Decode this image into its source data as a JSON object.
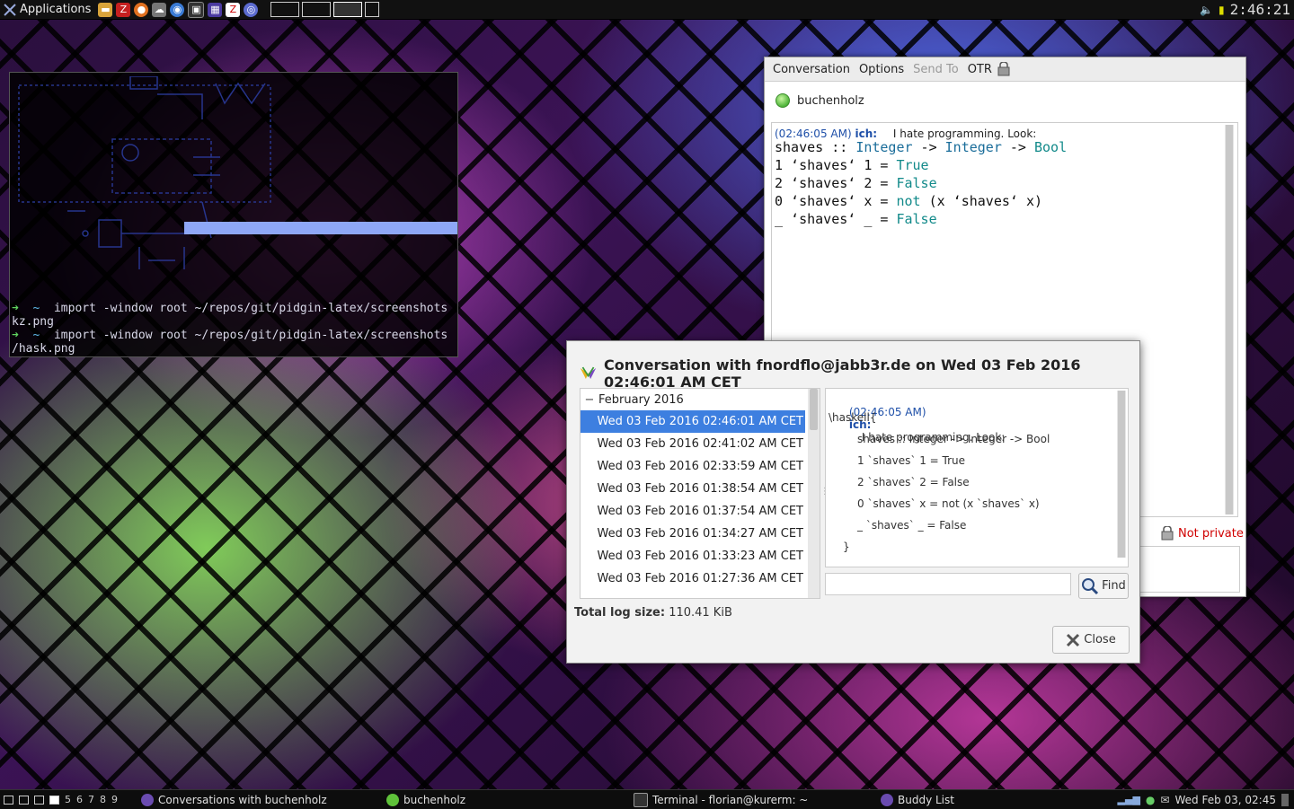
{
  "top_panel": {
    "applications_label": "Applications",
    "clock": "2:46:21"
  },
  "terminal": {
    "lines": [
      {
        "arrow": "➜",
        "tilde": "~",
        "cmd": "import -window root ~/repos/git/pidgin-latex/screenshots"
      },
      {
        "cont": "kz.png"
      },
      {
        "arrow": "➜",
        "tilde": "~",
        "cmd": "import -window root ~/repos/git/pidgin-latex/screenshots"
      },
      {
        "cont": "/hask.png"
      }
    ]
  },
  "conversation": {
    "menu": {
      "conversation": "Conversation",
      "options": "Options",
      "send_to": "Send To",
      "otr": "OTR"
    },
    "buddy": "buchenholz",
    "message": {
      "timestamp": "(02:46:05 AM)",
      "nick": "ich:",
      "text": "I hate programming. Look:"
    },
    "code": {
      "l1_a": "shaves :: ",
      "l1_t1": "Integer",
      "l1_b": " -> ",
      "l1_t2": "Integer",
      "l1_c": " -> ",
      "l1_t3": "Bool",
      "l2_a": "1 ‘shaves‘ 1 = ",
      "l2_v": "True",
      "l3_a": "2 ‘shaves‘ 2 = ",
      "l3_v": "False",
      "l4_a": "0 ‘shaves‘ x = ",
      "l4_v": "not",
      "l4_b": " (x ‘shaves‘ x)",
      "l5_a": "_ ‘shaves‘ _ = ",
      "l5_v": "False"
    },
    "otr_status": "Not private"
  },
  "log_viewer": {
    "title": "Conversation with fnordflo@jabb3r.de on Wed 03 Feb 2016 02:46:01 AM CET",
    "month": "February 2016",
    "logs": [
      "Wed 03 Feb 2016 02:46:01 AM CET",
      "Wed 03 Feb 2016 02:41:02 AM CET",
      "Wed 03 Feb 2016 02:33:59 AM CET",
      "Wed 03 Feb 2016 01:38:54 AM CET",
      "Wed 03 Feb 2016 01:37:54 AM CET",
      "Wed 03 Feb 2016 01:34:27 AM CET",
      "Wed 03 Feb 2016 01:33:23 AM CET",
      "Wed 03 Feb 2016 01:27:36 AM CET"
    ],
    "selected_index": 0,
    "view": {
      "timestamp": "(02:46:05 AM)",
      "nick": "ich:",
      "text": "I hate programming. Look:",
      "lines": [
        "\\haskell{",
        "shaves :: Integer -> Integer -> Bool",
        "1 `shaves` 1 = True",
        "2 `shaves` 2 = False",
        "0 `shaves` x = not (x `shaves` x)",
        "_ `shaves` _ = False",
        "}"
      ]
    },
    "search_value": "",
    "find_label": "Find",
    "total_label": "Total log size:",
    "total_value": "110.41 KiB",
    "close_label": "Close"
  },
  "taskbar": {
    "workspaces": [
      "5",
      "6",
      "7",
      "8",
      "9"
    ],
    "tasks": [
      {
        "label": "Conversations with buchenholz"
      },
      {
        "label": "buchenholz"
      },
      {
        "label": "Terminal - florian@kurerm: ~"
      },
      {
        "label": "Buddy List"
      }
    ],
    "clock": "Wed Feb 03, 02:45"
  },
  "colors": {
    "selection": "#3d7fe0",
    "otr_red": "#d00000",
    "timestamp_blue": "#1e4fa8",
    "terminal_bar": "#8ea7f6"
  }
}
